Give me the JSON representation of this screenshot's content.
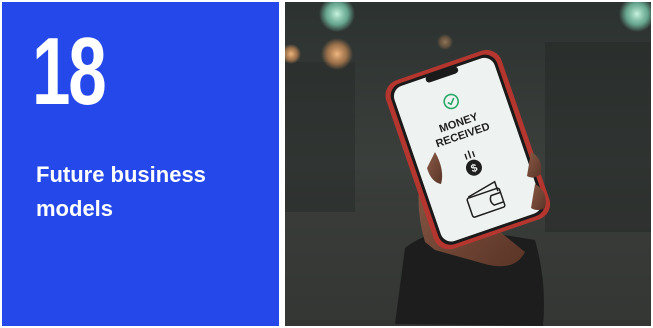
{
  "card": {
    "number": "18",
    "title": "Future business models",
    "background": "#2448ea"
  },
  "photo": {
    "phone_screen": {
      "status_icon": "check-circle-icon",
      "headline_line1": "MONEY",
      "headline_line2": "RECEIVED",
      "money_icon": "dollar-coin-icon",
      "wallet_icon": "wallet-icon"
    }
  }
}
